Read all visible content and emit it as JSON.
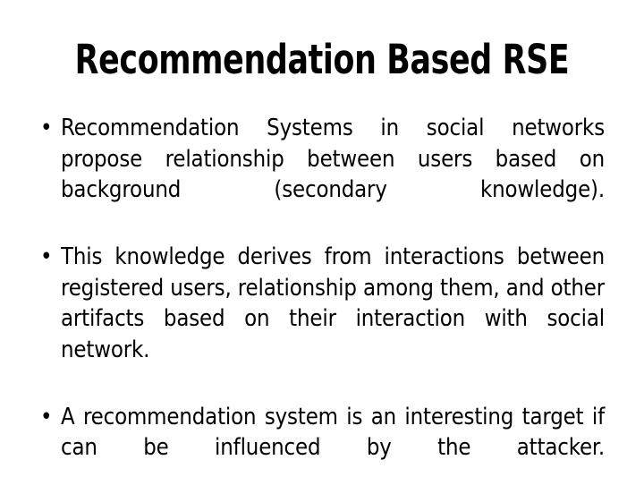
{
  "slide": {
    "title": "Recommendation Based RSE",
    "background_color": "#ffffff",
    "text_color": "#000000",
    "bullet_glyph": "•",
    "bullets": [
      {
        "marker": "•",
        "text": "Recommendation Systems in social networks propose relationship between users based on background (secondary knowledge)."
      },
      {
        "marker": "•",
        "text": "This knowledge derives from interactions between registered users, relationship among them, and other artifacts based on their interaction with social network."
      },
      {
        "marker": "•",
        "text": "A recommendation system is an interesting target if can be influenced by the attacker."
      }
    ]
  }
}
